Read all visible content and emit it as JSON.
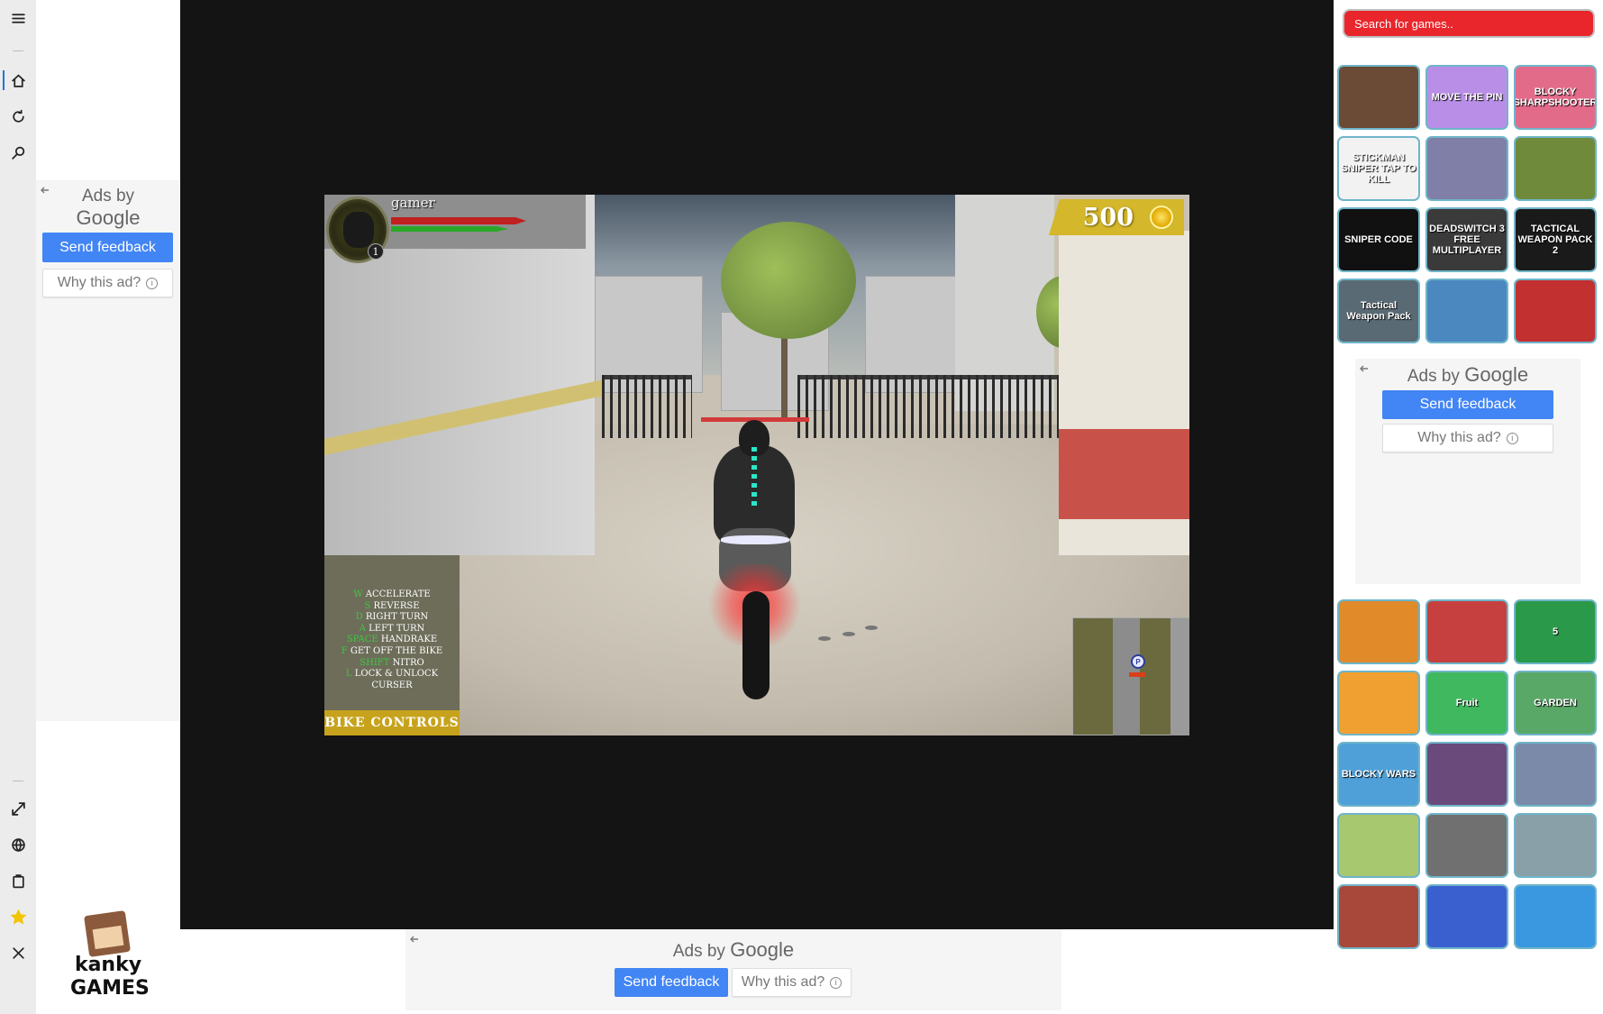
{
  "rail": {
    "icons": [
      "menu-icon",
      "home-icon",
      "refresh-icon",
      "search-icon",
      "fullscreen-icon",
      "globe-icon",
      "clipboard-icon",
      "star-icon",
      "close-icon"
    ]
  },
  "ads": {
    "ads_by": "Ads by",
    "google": "Google",
    "send_feedback": "Send feedback",
    "why_this_ad": "Why this ad?",
    "info_glyph": "i"
  },
  "game": {
    "player_name": "gamer",
    "level": "1",
    "coins": "500",
    "map_marker": "P",
    "controls": [
      {
        "key": "W",
        "action": "ACCELERATE"
      },
      {
        "key": "S",
        "action": "REVERSE"
      },
      {
        "key": "D",
        "action": "RIGHT TURN"
      },
      {
        "key": "A",
        "action": "LEFT TURN"
      },
      {
        "key": "SPACE",
        "action": "HANDRAKE"
      },
      {
        "key": "F",
        "action": "GET OFF THE BIKE"
      },
      {
        "key": "SHIFT",
        "action": "NITRO"
      },
      {
        "key": "L",
        "action": "LOCK & UNLOCK CURSER"
      }
    ],
    "controls_title": "BIKE CONTROLS"
  },
  "sidebar": {
    "search_placeholder": "Search for games..",
    "top_games": [
      {
        "label": "",
        "bg": "#6b4a36"
      },
      {
        "label": "MOVE THE PIN",
        "bg": "#b98ee6"
      },
      {
        "label": "BLOCKY SHARPSHOOTER",
        "bg": "#e36b8a"
      },
      {
        "label": "STICKMAN SNIPER TAP TO KILL",
        "bg": "#f2f2f2"
      },
      {
        "label": "",
        "bg": "#7f7fa8"
      },
      {
        "label": "",
        "bg": "#6f8a3a"
      },
      {
        "label": "SNIPER CODE",
        "bg": "#111111"
      },
      {
        "label": "DEADSWITCH 3 FREE MULTIPLAYER",
        "bg": "#3a3a3a"
      },
      {
        "label": "TACTICAL WEAPON PACK 2",
        "bg": "#1a1a1a"
      },
      {
        "label": "Tactical Weapon Pack",
        "bg": "#5a6a74"
      },
      {
        "label": "",
        "bg": "#4b88c0"
      },
      {
        "label": "",
        "bg": "#c23030"
      }
    ],
    "bottom_games": [
      {
        "label": "",
        "bg": "#e08a2a"
      },
      {
        "label": "",
        "bg": "#c64040"
      },
      {
        "label": "5",
        "bg": "#2a9a4a"
      },
      {
        "label": "",
        "bg": "#f0a030"
      },
      {
        "label": "Fruit",
        "bg": "#40b860"
      },
      {
        "label": "GARDEN",
        "bg": "#5aa868"
      },
      {
        "label": "BLOCKY WARS",
        "bg": "#4fa0d8"
      },
      {
        "label": "",
        "bg": "#6a4a7a"
      },
      {
        "label": "",
        "bg": "#7a8aa8"
      },
      {
        "label": "",
        "bg": "#a8c870"
      },
      {
        "label": "",
        "bg": "#707070"
      },
      {
        "label": "",
        "bg": "#8aa0a8"
      },
      {
        "label": "",
        "bg": "#a8483a"
      },
      {
        "label": "",
        "bg": "#3a60d0"
      },
      {
        "label": "",
        "bg": "#3a98e0"
      }
    ]
  },
  "logo": {
    "line1": "kanky",
    "line2": "GAMES"
  }
}
